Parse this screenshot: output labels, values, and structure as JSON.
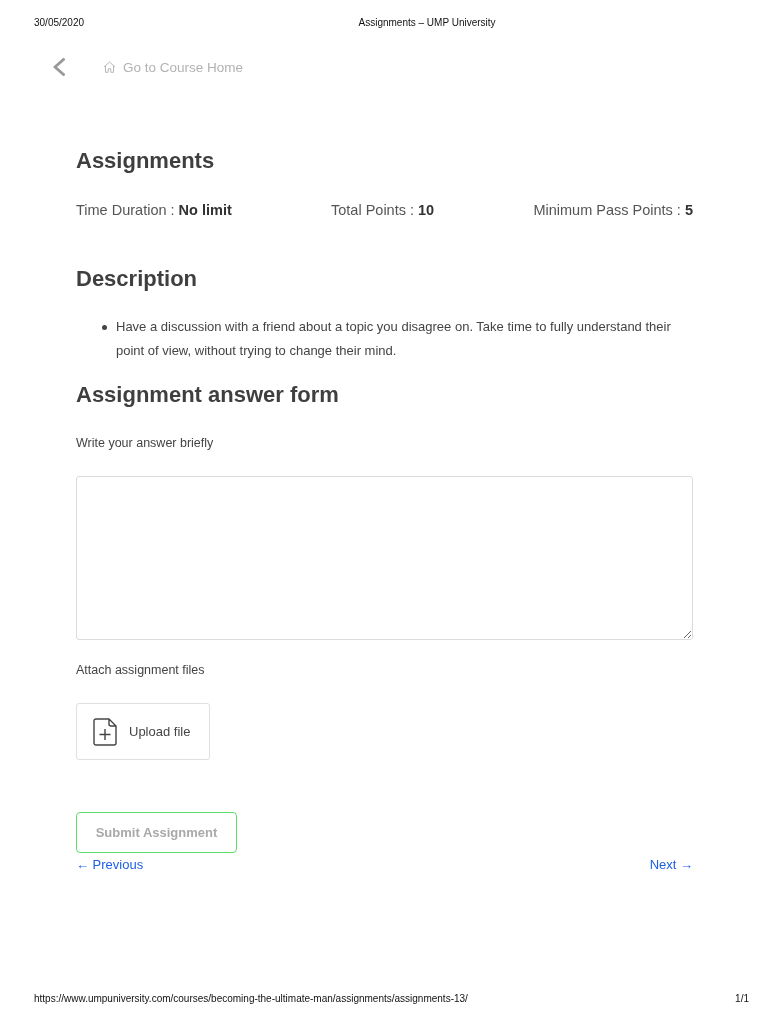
{
  "print_header": {
    "date": "30/05/2020",
    "title": "Assignments – UMP University"
  },
  "nav": {
    "home_link": "Go to Course Home"
  },
  "assignment": {
    "title": "Assignments",
    "stats": [
      {
        "label": "Time Duration :",
        "value": "No limit"
      },
      {
        "label": "Total Points :",
        "value": "10"
      },
      {
        "label": "Minimum Pass Points :",
        "value": "5"
      }
    ]
  },
  "description": {
    "title": "Description",
    "items": [
      "Have a discussion with a friend about a topic you disagree on. Take time to fully understand their point of view, without trying to change their mind."
    ]
  },
  "answer_form": {
    "title": "Assignment answer form",
    "answer_label": "Write your answer briefly",
    "attach_label": "Attach assignment files",
    "upload_button": "Upload file",
    "submit_button": {
      "label": "Submit Assignment",
      "disabled": true
    }
  },
  "pager": {
    "previous": "← Previous",
    "next": "Next →"
  },
  "print_footer": {
    "url": "https://www.umpuniversity.com/courses/becoming-the-ultimate-man/assignments/assignments-13/",
    "page": "1/1"
  }
}
